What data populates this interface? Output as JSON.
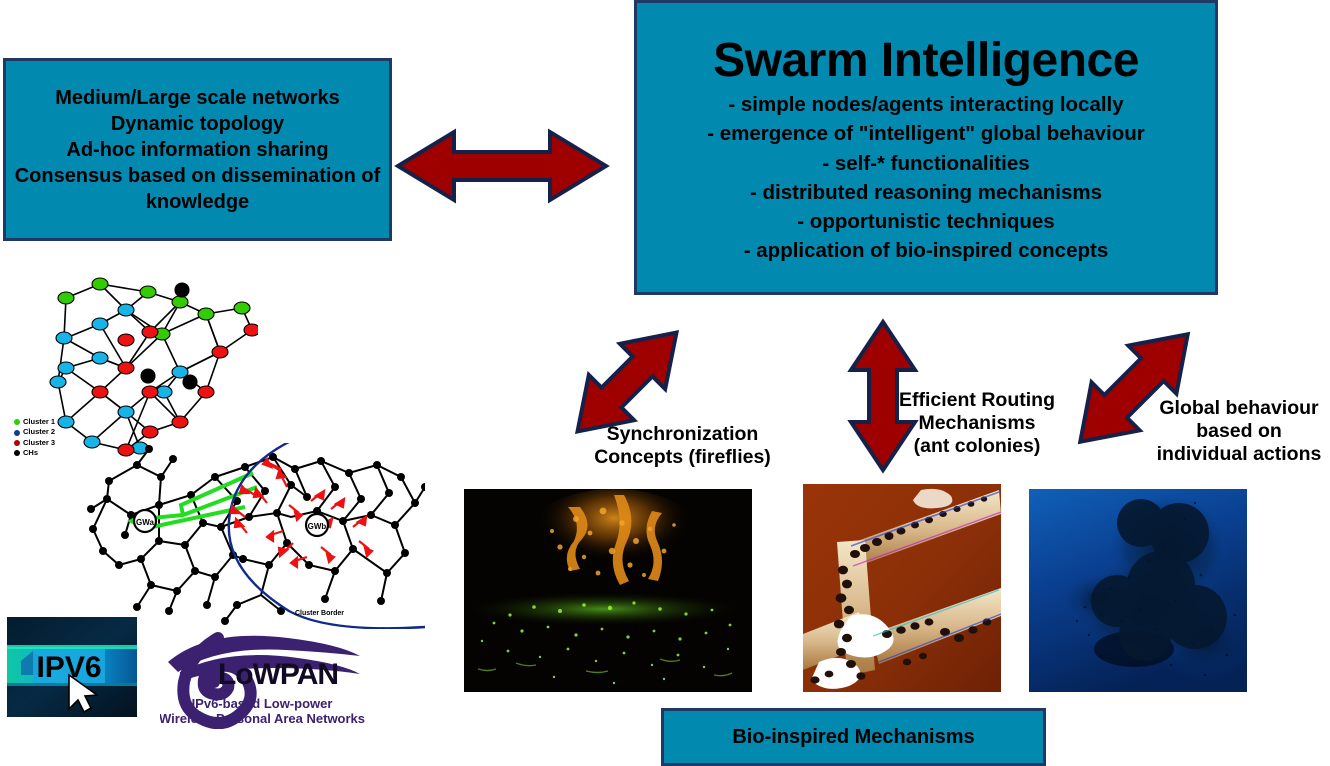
{
  "colors": {
    "box_fill": "#0189b0",
    "box_border": "#1f3864",
    "arrow_fill": "#9e0000",
    "arrow_outline": "#102040",
    "text": "#000000",
    "background": "#ffffff"
  },
  "swarm_box": {
    "title": "Swarm Intelligence",
    "bullets": [
      "-  simple nodes/agents interacting locally",
      "- emergence of \"intelligent\" global behaviour",
      "- self-* functionalities",
      "- distributed reasoning mechanisms",
      "- opportunistic techniques",
      "- application of bio-inspired concepts"
    ]
  },
  "network_box": {
    "lines": [
      "Medium/Large scale networks",
      "Dynamic topology",
      "Ad-hoc information sharing",
      "Consensus based on dissemination of knowledge"
    ]
  },
  "bio_box": {
    "label": "Bio-inspired Mechanisms"
  },
  "captions": {
    "synchronization": "Synchronization\nConcepts (fireflies)",
    "routing": "Efficient Routing\nMechanisms\n(ant colonies)",
    "global_behaviour": "Global behaviour\nbased on\nindividual actions"
  },
  "arrows": [
    {
      "name": "arrow-network-to-swarm",
      "direction": "horizontal-double"
    },
    {
      "name": "arrow-swarm-to-fireflies",
      "direction": "diagonal-double-up-right"
    },
    {
      "name": "arrow-swarm-to-ants",
      "direction": "vertical-double"
    },
    {
      "name": "arrow-swarm-to-birds",
      "direction": "diagonal-double-up-left"
    }
  ],
  "illustrations": {
    "clusters": {
      "name": "clustered-sensor-network-diagram",
      "legend": [
        {
          "label": "Cluster 1",
          "color": "#33cc00"
        },
        {
          "label": "Cluster 2",
          "color": "#0b3d91"
        },
        {
          "label": "Cluster 3",
          "color": "#b00000"
        },
        {
          "label": "CHs",
          "color": "#000000"
        }
      ]
    },
    "mesh": {
      "name": "mesh-routing-diagram",
      "node_labels": [
        "GWa",
        "GWb"
      ],
      "annotation": "Cluster Border"
    },
    "ipv6_logo": {
      "text": "IPV6"
    },
    "sixlowpan_logo": {
      "mark": "6",
      "name": "LoWPAN",
      "tagline_line1": "IPv6-based Low-power",
      "tagline_line2": "Wireless Personal Area Networks"
    }
  },
  "photos": [
    {
      "name": "fireflies-photo",
      "subject": "fireflies glowing at night over a field"
    },
    {
      "name": "ant-colony-photo",
      "subject": "ant colony trail on branches"
    },
    {
      "name": "bird-flock-photo",
      "subject": "starling murmuration against blue sky"
    }
  ]
}
